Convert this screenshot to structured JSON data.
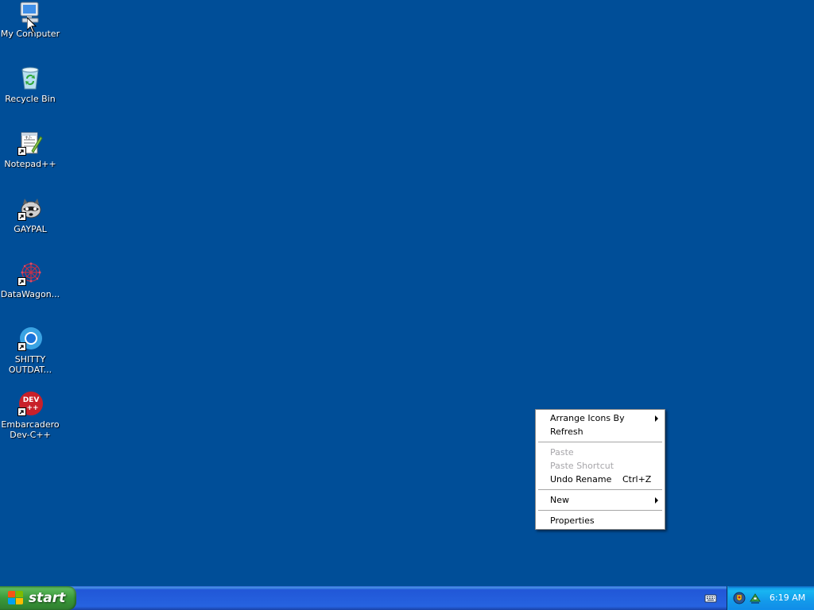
{
  "desktop": {
    "icons": [
      {
        "label": "My Computer"
      },
      {
        "label": "Recycle Bin"
      },
      {
        "label": "Notepad++"
      },
      {
        "label": "GAYPAL"
      },
      {
        "label": "DataWagon..."
      },
      {
        "label": "SHITTY\nOUTDAT..."
      },
      {
        "label": "Embarcadero\nDev-C++"
      }
    ]
  },
  "context_menu": {
    "arrange_icons": "Arrange Icons By",
    "refresh": "Refresh",
    "paste": "Paste",
    "paste_shortcut": "Paste Shortcut",
    "undo_rename": "Undo Rename",
    "undo_rename_shortcut": "Ctrl+Z",
    "new": "New",
    "properties": "Properties"
  },
  "taskbar": {
    "start_label": "start",
    "clock": "6:19 AM"
  },
  "colors": {
    "desktop_background": "#004e98",
    "taskbar": "#245edb",
    "start_button": "#3a9a3a",
    "tray": "#139beb"
  }
}
